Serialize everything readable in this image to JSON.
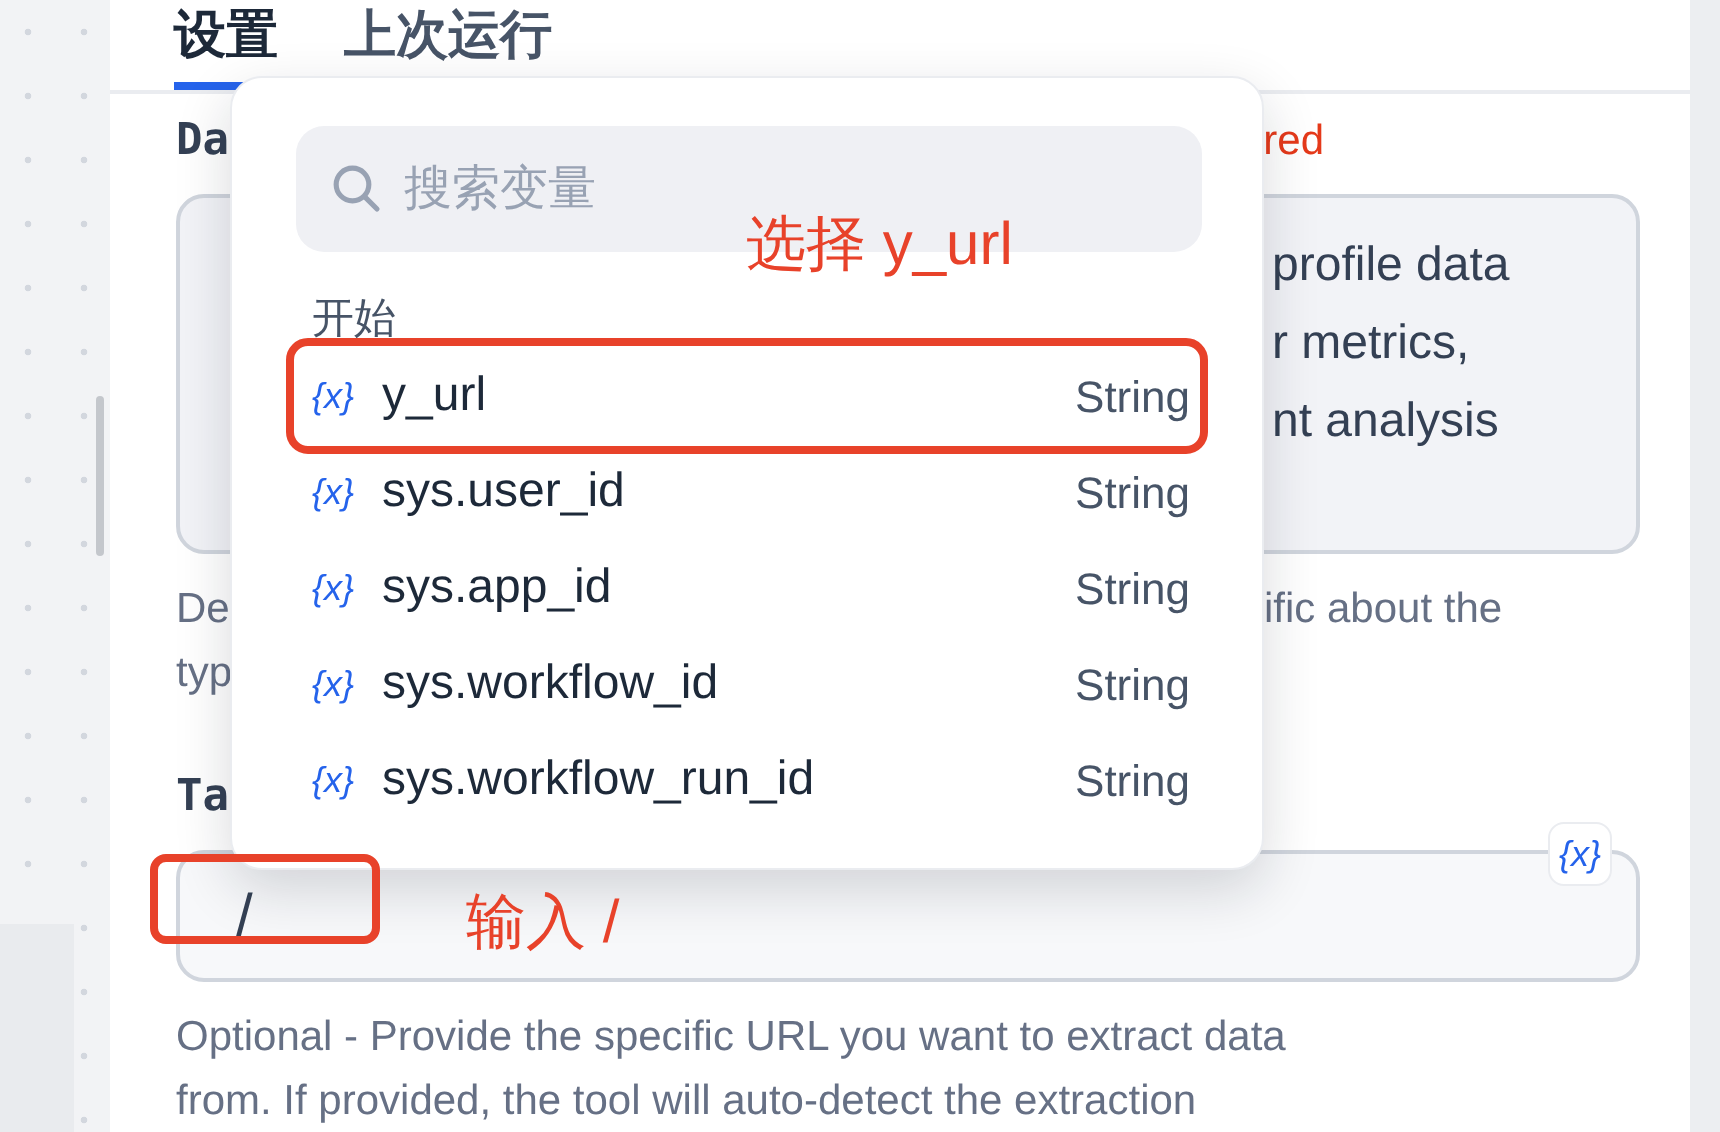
{
  "tabs": [
    {
      "label": "设置",
      "selected": true
    },
    {
      "label": "上次运行",
      "selected": false
    }
  ],
  "fields": [
    {
      "kind": "textarea",
      "label": "Da",
      "required": "red",
      "value": "profile data\nr metrics,\nnt analysis",
      "help_lines": [
        {
          "left": "De",
          "right": "ific about the"
        },
        {
          "left": "typ"
        }
      ]
    },
    {
      "kind": "input",
      "label": "Ta",
      "value": "/",
      "variable_button": "{x}",
      "help_lines": [
        {
          "left": "Optional - Provide the specific URL you want to extract data"
        },
        {
          "left": "from. If provided, the tool will auto-detect the extraction"
        }
      ]
    }
  ],
  "variable_menu": {
    "placeholder": "搜索变量",
    "group": "开始",
    "items": [
      {
        "icon": "{x}",
        "name": "y_url",
        "type": "String"
      },
      {
        "icon": "{x}",
        "name": "sys.user_id",
        "type": "String"
      },
      {
        "icon": "{x}",
        "name": "sys.app_id",
        "type": "String"
      },
      {
        "icon": "{x}",
        "name": "sys.workflow_id",
        "type": "String"
      },
      {
        "icon": "{x}",
        "name": "sys.workflow_run_id",
        "type": "String"
      }
    ]
  },
  "annotations": [
    {
      "kind": "menu",
      "text": "选择 y_url"
    },
    {
      "kind": "input",
      "text": "输入 /"
    }
  ]
}
